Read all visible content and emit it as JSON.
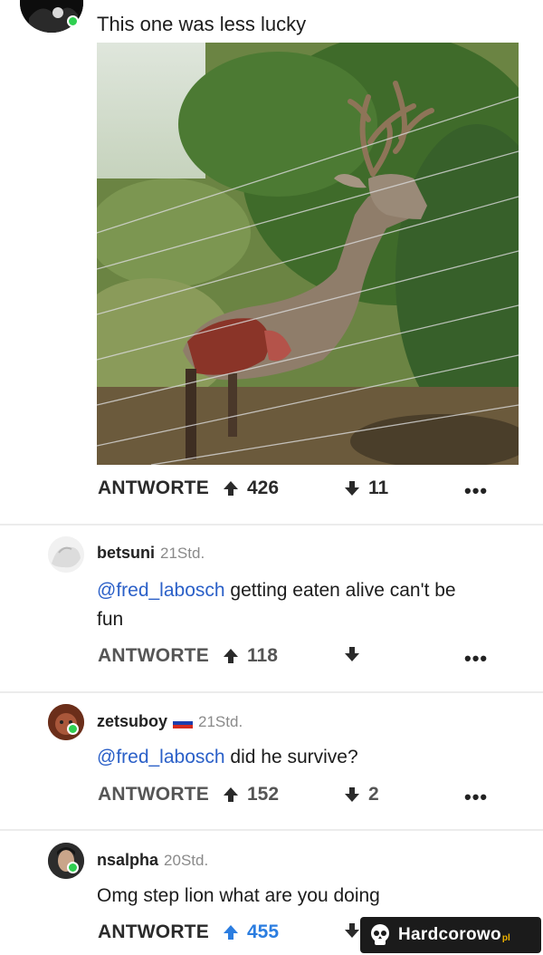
{
  "post": {
    "text": "This one was less lucky",
    "reply_label": "ANTWORTE",
    "upvotes": "426",
    "downvotes": "11",
    "more": "•••"
  },
  "comments": [
    {
      "username": "betsuni",
      "time": "21Std.",
      "mention": "@fred_labosch",
      "text_line1": " getting eaten alive can't be",
      "text_line2": "fun",
      "reply_label": "ANTWORTE",
      "upvotes": "118",
      "downvotes": "",
      "more": "•••"
    },
    {
      "username": "zetsuboy",
      "time": "21Std.",
      "mention": "@fred_labosch",
      "text": " did he survive?",
      "reply_label": "ANTWORTE",
      "upvotes": "152",
      "downvotes": "2",
      "more": "•••"
    },
    {
      "username": "nsalpha",
      "time": "20Std.",
      "text": "Omg step lion what are you doing",
      "reply_label": "ANTWORTE",
      "upvotes": "455",
      "upvote_color": "#2b7de0"
    }
  ],
  "watermark": {
    "text": "Hardcorowo",
    "suffix": "pl"
  },
  "colors": {
    "online_dot": "#2fcf50",
    "mention": "#2b60c8",
    "upvoted": "#2b7de0"
  }
}
